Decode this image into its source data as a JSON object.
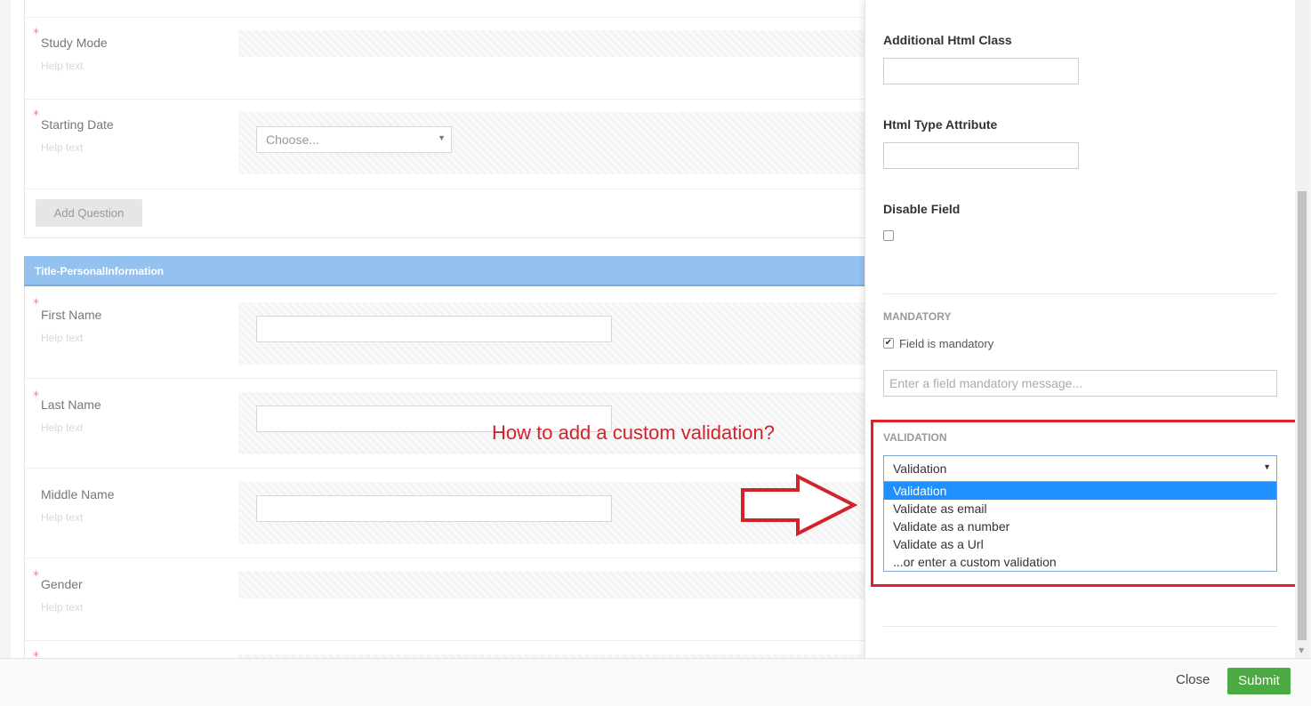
{
  "builder": {
    "questions_top": [
      {
        "label": "Study Mode",
        "help": "Help text",
        "required": true
      },
      {
        "label": "Starting Date",
        "help": "Help text",
        "required": true,
        "select_placeholder": "Choose..."
      }
    ],
    "add_question_label": "Add Question",
    "section_title": "Title-PersonalInformation",
    "questions_bottom": [
      {
        "label": "First Name",
        "help": "Help text",
        "required": true
      },
      {
        "label": "Last Name",
        "help": "Help text",
        "required": true
      },
      {
        "label": "Middle Name",
        "help": "Help text",
        "required": false
      },
      {
        "label": "Gender",
        "help": "Help text",
        "required": true
      }
    ],
    "required_marker": "*"
  },
  "annotation": {
    "text": "How to add a custom validation?",
    "color": "#d3232a"
  },
  "panel": {
    "additional_html_class_label": "Additional Html Class",
    "html_type_attribute_label": "Html Type Attribute",
    "disable_field_label": "Disable Field",
    "disable_field_checked": false,
    "mandatory_section": "MANDATORY",
    "field_is_mandatory_label": "Field is mandatory",
    "field_is_mandatory_checked": true,
    "mandatory_message_placeholder": "Enter a field mandatory message...",
    "validation_section": "VALIDATION",
    "validation_selected": "Validation",
    "validation_options": [
      "Validation",
      "Validate as email",
      "Validate as a number",
      "Validate as a Url",
      "...or enter a custom validation"
    ]
  },
  "footer": {
    "close_label": "Close",
    "submit_label": "Submit",
    "submit_color": "#4caa43"
  }
}
